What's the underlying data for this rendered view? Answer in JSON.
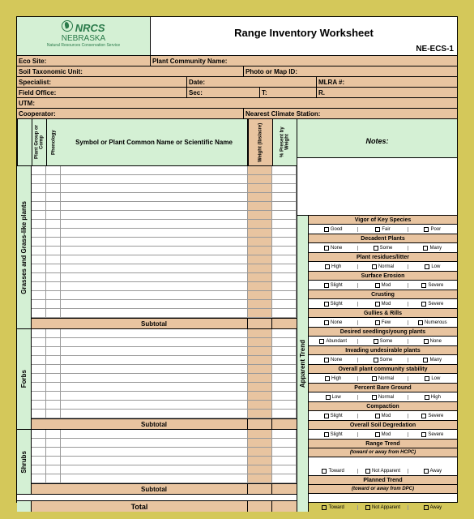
{
  "header": {
    "org": "NRCS",
    "state": "NEBRASKA",
    "tagline": "Natural Resources Conservation Service",
    "title": "Range Inventory Worksheet",
    "code": "NE-ECS-1"
  },
  "meta": {
    "eco": "Eco Site:",
    "plant": "Plant Community Name:",
    "soil": "Soil Taxonomic Unit:",
    "photo": "Photo or Map ID:",
    "spec": "Specialist:",
    "date": "Date:",
    "mlra": "MLRA #:",
    "office": "Field Office:",
    "sec": "Sec:",
    "t": "T:",
    "r": "R.",
    "utm": "UTM:",
    "coop": "Cooperator:",
    "climate": "Nearest Climate Station:"
  },
  "cols": {
    "c1": "Plant Group or Comp",
    "c2": "Phenology",
    "c3": "Symbol or Plant Common Name or Scientific Name",
    "c4": "Weight (lbs/acre)",
    "c5": "% Present by Weight"
  },
  "groups": [
    {
      "name": "Grasses and Grass-like plants",
      "rows": 17
    },
    {
      "name": "Forbs",
      "rows": 10
    },
    {
      "name": "Shrubs",
      "rows": 6
    }
  ],
  "subtotal": "Subtotal",
  "total": "Total",
  "notes": "Notes:",
  "trend": "Apparent Trend",
  "assess": [
    {
      "h": "Vigor of Key Species",
      "opts": [
        "Good",
        "Fair",
        "Poor"
      ]
    },
    {
      "h": "Decadent Plants",
      "opts": [
        "None",
        "Some",
        "Many"
      ]
    },
    {
      "h": "Plant residues/litter",
      "opts": [
        "High",
        "Normal",
        "Low"
      ]
    },
    {
      "h": "Surface Erosion",
      "opts": [
        "Slight",
        "Mod",
        "Severe"
      ]
    },
    {
      "h": "Crusting",
      "opts": [
        "Slight",
        "Mod",
        "Severe"
      ]
    },
    {
      "h": "Gullies & Rills",
      "opts": [
        "None",
        "Few",
        "Numerous"
      ]
    },
    {
      "h": "Desired seedlings/young plants",
      "opts": [
        "Abundant",
        "Some",
        "None"
      ]
    },
    {
      "h": "Invading undesirable plants",
      "opts": [
        "None",
        "Some",
        "Many"
      ]
    },
    {
      "h": "Overall plant community stability",
      "opts": [
        "High",
        "Normal",
        "Low"
      ]
    },
    {
      "h": "Percent Bare Ground",
      "opts": [
        "Low",
        "Normal",
        "High"
      ]
    },
    {
      "h": "Compaction",
      "opts": [
        "Slight",
        "Mod",
        "Severe"
      ]
    },
    {
      "h": "Overall Soil Degredation",
      "opts": [
        "Slight",
        "Mod",
        "Severe"
      ]
    },
    {
      "h": "Range Trend",
      "sub": "(toward or away from HCPC)",
      "opts": [
        "Toward",
        "Not Apparent",
        "Away"
      ]
    },
    {
      "h": "Planned Trend",
      "sub": "(toward or away from DPC)",
      "opts": [
        "Toward",
        "Not Apparent",
        "Away"
      ]
    }
  ]
}
